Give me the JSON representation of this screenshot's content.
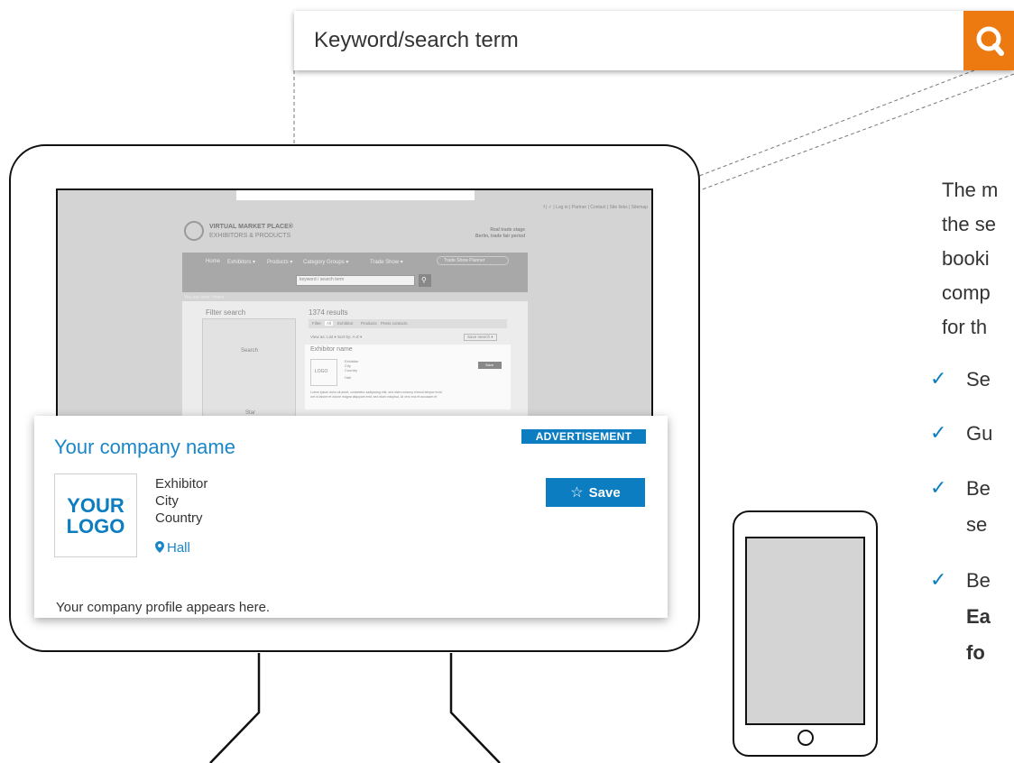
{
  "search": {
    "placeholder": "Keyword/search term"
  },
  "website": {
    "top_links": "f | ✓ | Log in | Partner | Contact | Site links | Sitemap",
    "brand_line1": "VIRTUAL MARKET PLACE®",
    "brand_line2": "EXHIBITORS & PRODUCTS",
    "event_line1": "Real trade stage",
    "event_line2": "Berlin, trade fair period",
    "nav": [
      "Home",
      "Exhibitors ▾",
      "Products ▾",
      "Category Groups ▾",
      "Trade Show ▾"
    ],
    "nav_right": "Trade Show Planner",
    "search_placeholder": "keyword / search term",
    "breadcrumb": "You are here: Home",
    "filter_title": "Filter search",
    "results": "1374 results",
    "tabs": [
      "Filter",
      "All",
      "Exhibitor",
      "Products",
      "Press contacts"
    ],
    "view_line": "View as: List ▾   Sort by: A-Z ▾",
    "save_search": "Save search ▾",
    "exhibitor_name": "Exhibitor name",
    "logo": "LOGO",
    "info_lines": [
      "Exhibitor",
      "City",
      "Country"
    ],
    "hall": "Hall",
    "save": "Save",
    "lorem": "Lorem ipsum dolor sit amet, consetetur sadipscing elitr, sed diam nonumy eirmod tempor invid",
    "lorem2": "unt ut labore et dolore magna aliquyam erat, sed diam voluptua. At vero eos et accusam et",
    "sidebar_search": "Search",
    "sidebar_star": "Star"
  },
  "ad": {
    "company_name": "Your company name",
    "badge": "ADVERTISEMENT",
    "logo_line1": "YOUR",
    "logo_line2": "LOGO",
    "info": [
      "Exhibitor",
      "City",
      "Country"
    ],
    "hall": "Hall",
    "save_label": "Save",
    "profile": "Your company profile appears here."
  },
  "intro": [
    "The m",
    "the se",
    "booki",
    "comp",
    "for th"
  ],
  "bullets": [
    {
      "lines": [
        "Se"
      ],
      "bold": [
        false
      ]
    },
    {
      "lines": [
        "Gu"
      ],
      "bold": [
        false
      ]
    },
    {
      "lines": [
        "Be",
        "se"
      ],
      "bold": [
        false,
        false
      ]
    },
    {
      "lines": [
        "Be",
        "Ea",
        "fo"
      ],
      "bold": [
        false,
        true,
        true
      ]
    }
  ],
  "colors": {
    "accent": "#0b7dc0",
    "search_button": "#ec7a10",
    "link": "#1a86c8"
  },
  "icons": {
    "search": "magnifier-icon",
    "save": "star-outline-icon",
    "hall": "map-pin-icon",
    "check": "checkmark-icon"
  }
}
